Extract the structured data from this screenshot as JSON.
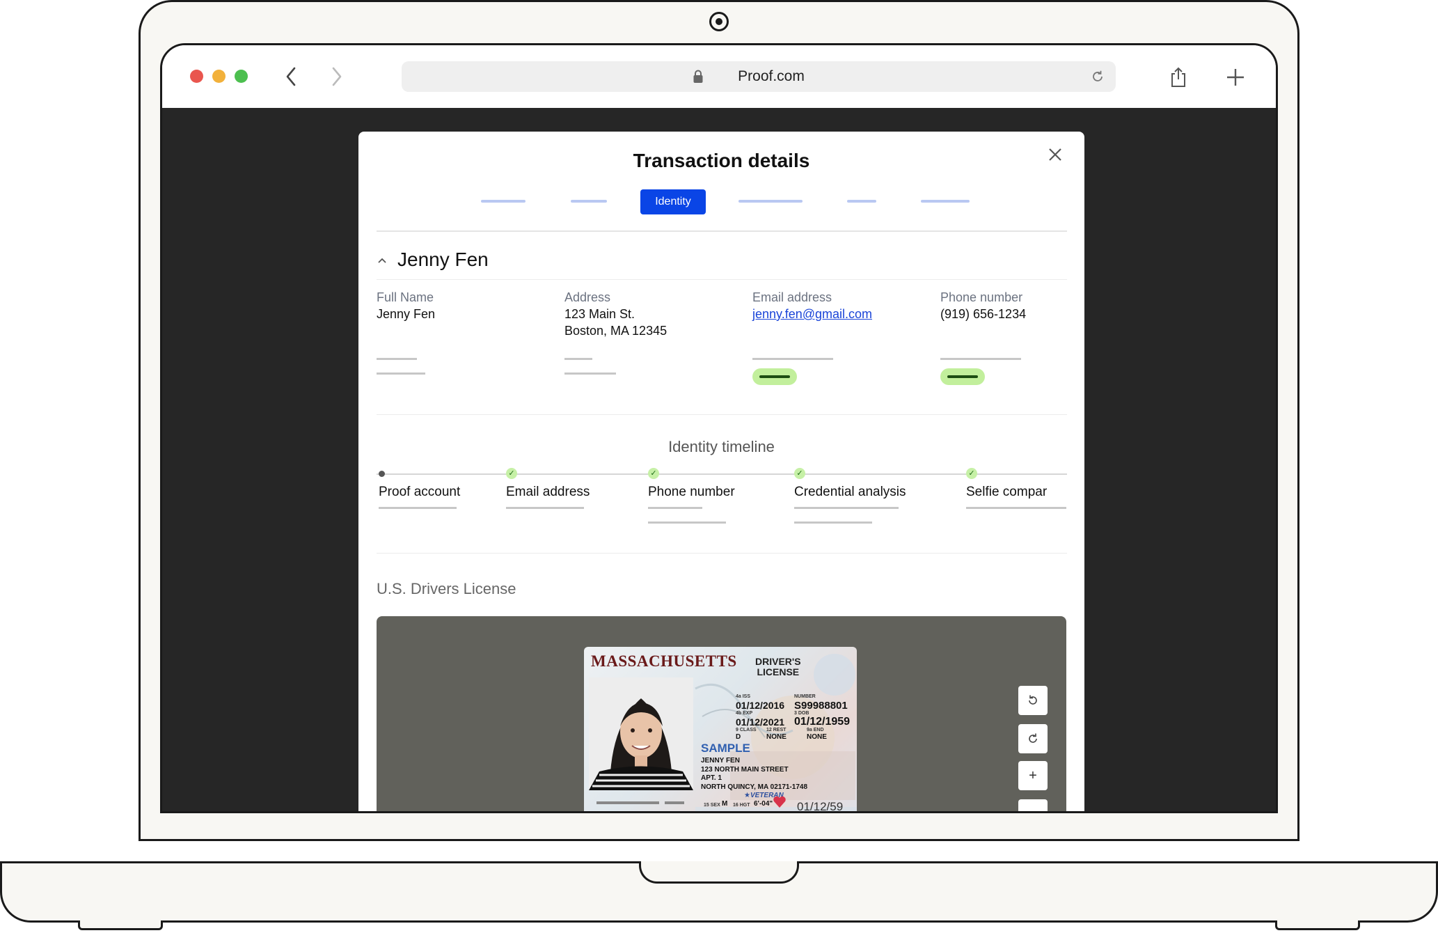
{
  "browser": {
    "url": "Proof.com",
    "back_icon": "chevron-left-icon",
    "forward_icon": "chevron-right-icon",
    "lock_icon": "lock-icon",
    "reload_icon": "reload-icon",
    "share_icon": "share-icon",
    "new_tab_icon": "plus-icon",
    "traffic_lights": [
      "#e9564e",
      "#f2b13b",
      "#4cbf4f"
    ]
  },
  "modal": {
    "title": "Transaction details",
    "close_icon": "close-icon",
    "active_tab": "Identity",
    "accent": "#0a45e6"
  },
  "signer": {
    "name": "Jenny Fen",
    "collapse_icon": "chevron-up-icon",
    "fields": {
      "full_name": {
        "label": "Full Name",
        "value": "Jenny Fen"
      },
      "address": {
        "label": "Address",
        "line1": "123 Main St.",
        "line2": "Boston, MA 12345"
      },
      "email": {
        "label": "Email address",
        "value": "jenny.fen@gmail.com"
      },
      "phone": {
        "label": "Phone number",
        "value": "(919) 656-1234"
      }
    },
    "success_color": "#c2ef9c"
  },
  "timeline": {
    "title": "Identity timeline",
    "steps": [
      {
        "label": "Proof account",
        "status": "neutral"
      },
      {
        "label": "Email address",
        "status": "passed"
      },
      {
        "label": "Phone number",
        "status": "passed"
      },
      {
        "label": "Credential analysis",
        "status": "passed"
      },
      {
        "label": "Selfie compar",
        "status": "passed"
      }
    ]
  },
  "document": {
    "title": "U.S. Drivers License",
    "tools": [
      "rotate-left-icon",
      "rotate-right-icon",
      "zoom-in-icon",
      "zoom-out-icon"
    ],
    "zoom_in_glyph": "+",
    "license": {
      "state": "MASSACHUSETTS",
      "type_line1": "DRIVER'S",
      "type_line2": "LICENSE",
      "iss_label": "4a ISS",
      "iss": "01/12/2016",
      "number_label": "NUMBER",
      "number": "S99988801",
      "exp_label": "4b EXP",
      "exp": "01/12/2021",
      "dob_label": "3 DOB",
      "dob": "01/12/1959",
      "class_label": "9 CLASS",
      "class": "D",
      "rest_label": "12 REST",
      "rest": "NONE",
      "end_label": "9a END",
      "end": "NONE",
      "sample": "SAMPLE",
      "holder": "JENNY FEN",
      "street": "123 NORTH MAIN STREET",
      "apt": "APT. 1",
      "city": "NORTH QUINCY, MA 02171-1748",
      "veteran": "★VETERAN",
      "sex_label": "15 SEX",
      "sex": "M",
      "hgt_label": "16 HGT",
      "hgt": "6'-04\"",
      "footer_date": "01/12/59"
    }
  }
}
